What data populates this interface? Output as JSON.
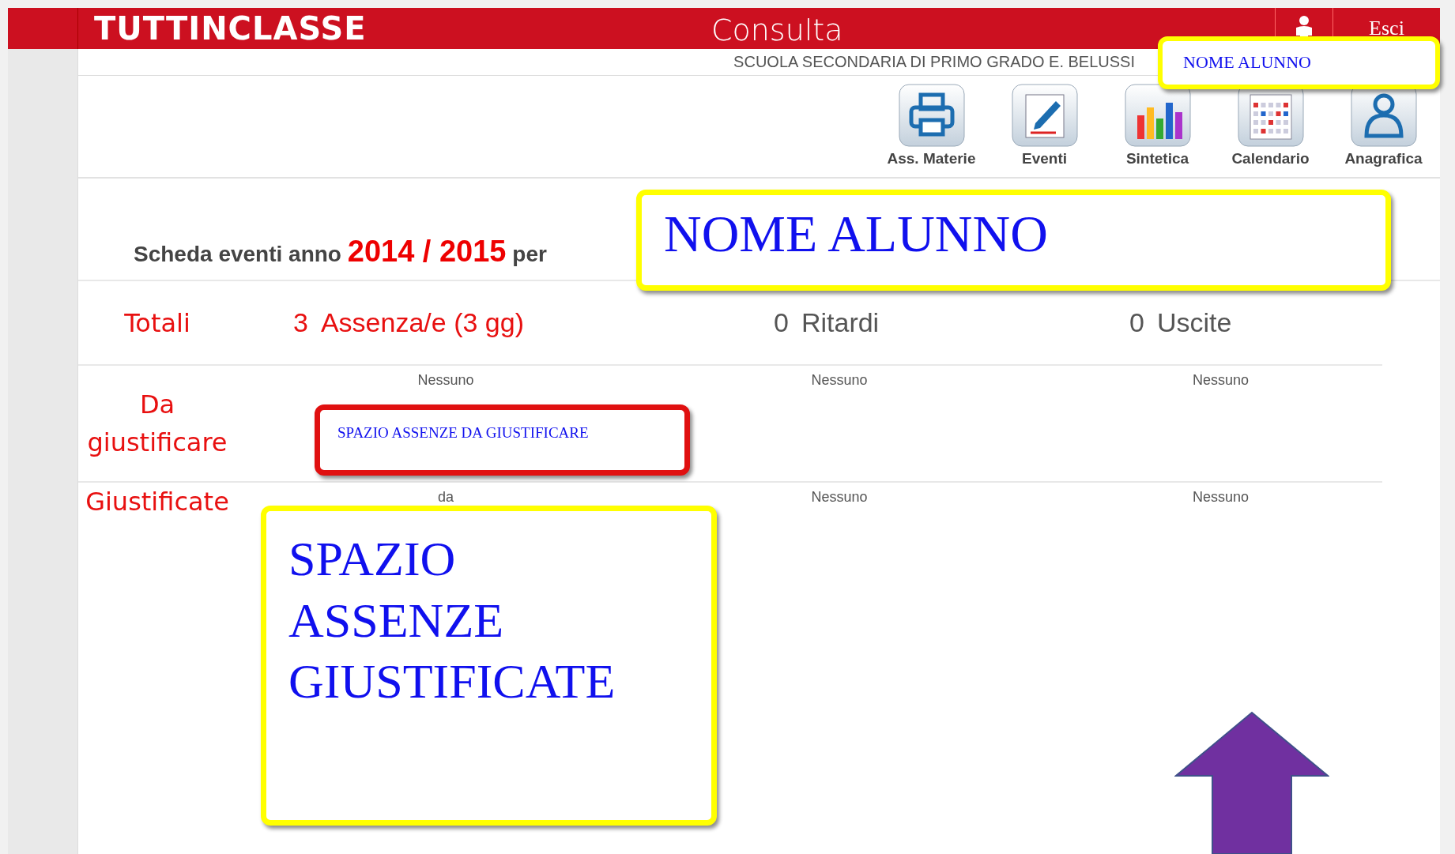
{
  "header": {
    "logo": "TUTTINCLASSE",
    "title": "Consulta",
    "logout": "Esci"
  },
  "school": "SCUOLA SECONDARIA DI PRIMO GRADO E. BELUSSI",
  "toolbar": [
    {
      "label": "Ass. Materie"
    },
    {
      "label": "Eventi"
    },
    {
      "label": "Sintetica"
    },
    {
      "label": "Calendario"
    },
    {
      "label": "Anagrafica"
    }
  ],
  "heading": {
    "text": "Scheda eventi anno",
    "year": "2014 / 2015",
    "suffix": "per"
  },
  "totals": {
    "label": "Totali",
    "items": [
      {
        "count": "3",
        "label": "Assenza/e (3 gg)",
        "alert": true
      },
      {
        "count": "0",
        "label": "Ritardi",
        "alert": false
      },
      {
        "count": "0",
        "label": "Uscite",
        "alert": false
      }
    ]
  },
  "rows": [
    {
      "label": "Da giustificare",
      "cells": [
        "Nessuno",
        "Nessuno",
        "Nessuno"
      ]
    },
    {
      "label": "Giustificate",
      "cells": [
        "da",
        "Nessuno",
        "Nessuno"
      ]
    }
  ],
  "annotations": [
    {
      "kind": "label-small",
      "color": "#ffff00",
      "text": "NOME ALUNNO"
    },
    {
      "kind": "label-large",
      "color": "#ffff00",
      "text": "NOME ALUNNO"
    },
    {
      "kind": "callout",
      "color": "#e01010",
      "text": "SPAZIO ASSENZE DA GIUSTIFICARE"
    },
    {
      "kind": "callout-large",
      "color": "#ffff00",
      "text": "SPAZIO ASSENZE GIUSTIFICATE"
    },
    {
      "kind": "arrow",
      "color": "#7030a0"
    }
  ]
}
